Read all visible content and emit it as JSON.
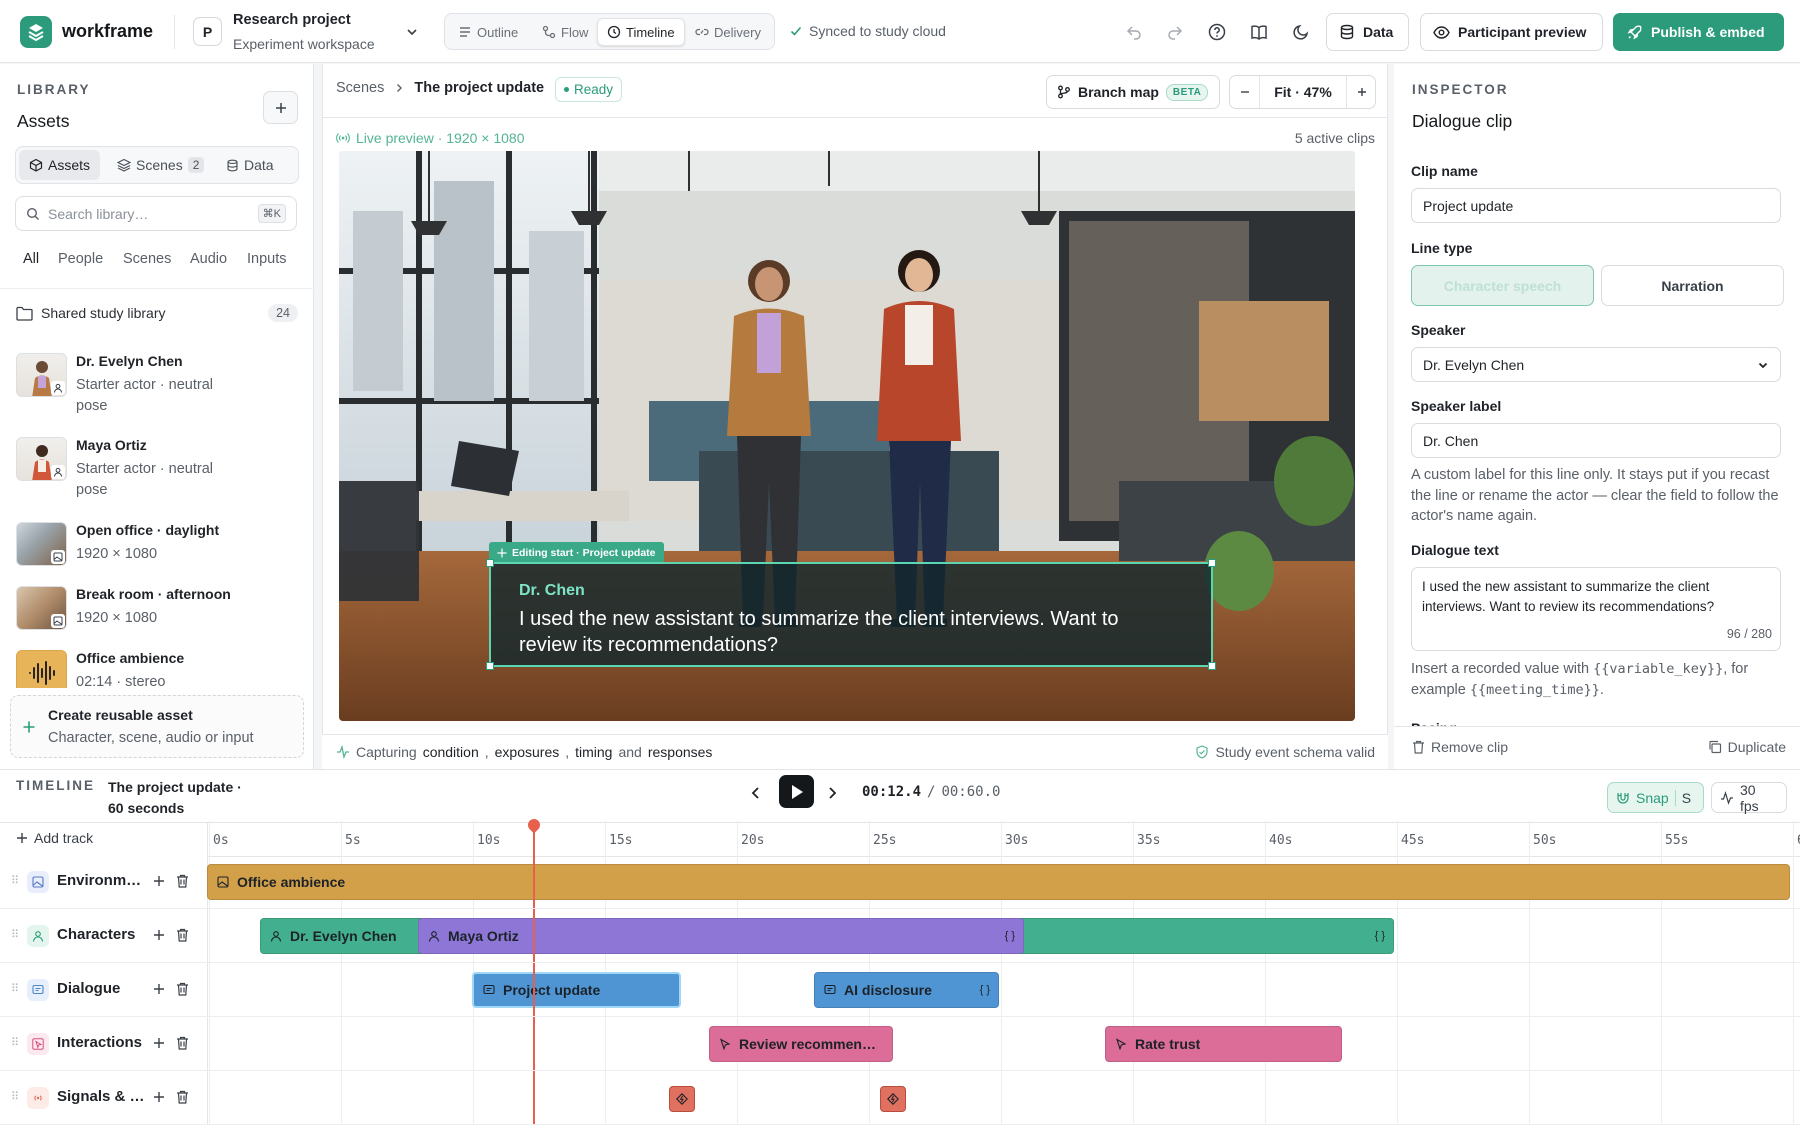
{
  "app": {
    "brand": "workframe"
  },
  "project": {
    "initial": "P",
    "title": "Research project",
    "subtitle": "Experiment workspace"
  },
  "views": {
    "outline": "Outline",
    "flow": "Flow",
    "timeline": "Timeline",
    "delivery": "Delivery",
    "active": "Timeline"
  },
  "sync_status": "Synced to study cloud",
  "toolbar": {
    "data_label": "Data",
    "preview_label": "Participant preview",
    "publish_label": "Publish & embed"
  },
  "library": {
    "section": "LIBRARY",
    "title": "Assets",
    "tabs": [
      {
        "label": "Assets"
      },
      {
        "label": "Scenes",
        "count": "2"
      },
      {
        "label": "Data"
      }
    ],
    "search_placeholder": "Search library…",
    "search_shortcut": "⌘K",
    "filters": [
      "All",
      "People",
      "Scenes",
      "Audio",
      "Inputs"
    ],
    "folder": {
      "name": "Shared study library",
      "count": "24"
    },
    "assets": [
      {
        "name": "Dr. Evelyn Chen",
        "meta": "Starter actor · neutral pose",
        "kind": "actor"
      },
      {
        "name": "Maya Ortiz",
        "meta": "Starter actor · neutral pose",
        "kind": "actor"
      },
      {
        "name": "Open office · daylight",
        "meta": "1920 × 1080",
        "kind": "scene"
      },
      {
        "name": "Break room · afternoon",
        "meta": "1920 × 1080",
        "kind": "scene"
      },
      {
        "name": "Office ambience",
        "meta": "02:14 · stereo",
        "kind": "audio"
      }
    ],
    "create": {
      "title": "Create reusable asset",
      "subtitle": "Character, scene, audio or input"
    }
  },
  "stage": {
    "breadcrumb_root": "Scenes",
    "breadcrumb_current": "The project update",
    "status": "Ready",
    "branch_map": "Branch map",
    "beta": "BETA",
    "zoom": "Fit · 47%",
    "live_preview": "Live preview · 1920 × 1080",
    "active_clips": "5 active clips",
    "edit_tag": "Editing start · Project update",
    "caption_speaker": "Dr. Chen",
    "caption_text": "I used the new assistant to summarize the client interviews. Want to review its recommendations?",
    "capture": {
      "lead": "Capturing",
      "items": [
        "condition",
        "exposures",
        "timing",
        "responses"
      ],
      "sep1": ",",
      "sep2": ",",
      "and": "and",
      "schema": "Study event schema valid"
    }
  },
  "inspector": {
    "section": "INSPECTOR",
    "title": "Dialogue clip",
    "clip_name_label": "Clip name",
    "clip_name": "Project update",
    "line_type_label": "Line type",
    "line_type_options": [
      "Character speech",
      "Narration"
    ],
    "speaker_label": "Speaker",
    "speaker": "Dr. Evelyn Chen",
    "speaker_label_label": "Speaker label",
    "speaker_label_value": "Dr. Chen",
    "speaker_label_help": "A custom label for this line only. It stays put if you recast the line or rename the actor — clear the field to follow the actor's name again.",
    "dialogue_label": "Dialogue text",
    "dialogue_text": "I used the new assistant to summarize the client interviews. Want to review its recommendations?",
    "dialogue_count": "96 / 280",
    "variable_help_a": "Insert a recorded value with",
    "variable_token": "{{variable_key}}",
    "variable_help_b": ", for example",
    "variable_example": "{{meeting_time}}",
    "pacing_label": "Pacing",
    "remove": "Remove clip",
    "duplicate": "Duplicate"
  },
  "timeline": {
    "section": "TIMELINE",
    "title": "The project update · 60 seconds",
    "current_time": "00:12.4",
    "total_time": "00:60.0",
    "snap": "Snap",
    "snap_key": "S",
    "fps": "30 fps",
    "add_track": "Add track",
    "ticks": [
      "0s",
      "5s",
      "10s",
      "15s",
      "20s",
      "25s",
      "30s",
      "35s",
      "40s",
      "45s",
      "50s",
      "55s",
      "6"
    ],
    "tracks": [
      {
        "name": "Environm…",
        "color": "#e8eefc",
        "icon": "image-icon"
      },
      {
        "name": "Characters",
        "color": "#e4f5ee",
        "icon": "person-icon"
      },
      {
        "name": "Dialogue",
        "color": "#e6effb",
        "icon": "speech-icon"
      },
      {
        "name": "Interactions",
        "color": "#fce8ee",
        "icon": "cursor-icon"
      },
      {
        "name": "Signals & …",
        "color": "#fdebe7",
        "icon": "signal-icon"
      }
    ],
    "clips": {
      "ambience": "Office ambience",
      "chen": "Dr. Evelyn Chen",
      "ortiz": "Maya Ortiz",
      "project_update": "Project update",
      "ai_disclosure": "AI disclosure",
      "review": "Review recommen…",
      "rate_trust": "Rate trust"
    },
    "brace": "{ }"
  },
  "colors": {
    "accent": "#2b9b7b",
    "ambience": "#d3a04a",
    "chen": "#42b08e",
    "ortiz": "#8d76d6",
    "dialogue": "#4f95d3",
    "interaction": "#dc6c98",
    "signal": "#e0705f"
  }
}
